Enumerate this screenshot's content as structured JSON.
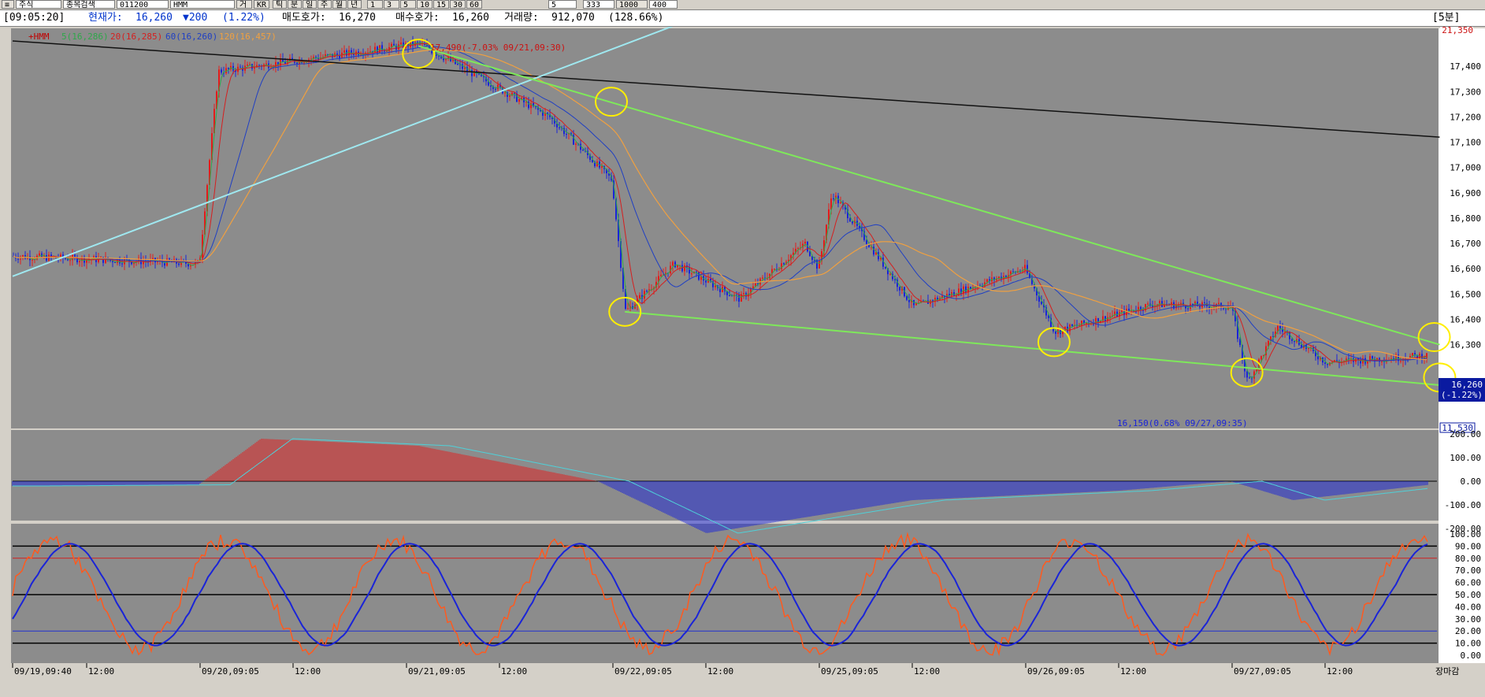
{
  "toolbar": {
    "market_select": "주식",
    "search_type": "종목검색",
    "code": "011200",
    "btn_prev": "거",
    "name": "HMM",
    "btn_kr": "KR",
    "period_tabs": [
      "틱",
      "분",
      "일",
      "주",
      "월",
      "년"
    ],
    "interval_tabs": [
      "1",
      "3",
      "5",
      "10",
      "15",
      "30",
      "60"
    ],
    "interval_value": "5",
    "count_value": "333",
    "count_total": "1000",
    "zoom_value": "400"
  },
  "infobar": {
    "time": "[09:05:20]",
    "price_label": "현재가:",
    "price": "16,260",
    "change": "▼200",
    "change_pct": "(1.22%)",
    "ask_label": "매도호가:",
    "ask": "16,270",
    "bid_label": "매수호가:",
    "bid": "16,260",
    "volume_label": "거래량:",
    "volume": "912,070",
    "volume_pct": "(128.66%)",
    "timeframe": "[5분]"
  },
  "legend": {
    "name": "HMM",
    "ma5": "5(16,286)",
    "ma20": "20(16,285)",
    "ma60": "60(16,260)",
    "ma120": "120(16,457)"
  },
  "annotations": {
    "high": "17,490(-7.03% 09/21,09:30)",
    "low": "16,150(0.68% 09/27,09:35)"
  },
  "price_axis": {
    "top_label": "21,350",
    "current_label": "16,260",
    "current_pct": "(-1.22%)",
    "bottom_label": "11,530"
  },
  "macd_axis": [
    "200.00",
    "100.00",
    "0.00",
    "-100.00",
    "-200.00"
  ],
  "stoch_axis": [
    "100.00",
    "90.00",
    "80.00",
    "70.00",
    "60.00",
    "50.00",
    "40.00",
    "30.00",
    "20.00",
    "10.00",
    "0.00"
  ],
  "time_axis": [
    "09/19,09:40",
    "12:00",
    "09/20,09:05",
    "12:00",
    "09/21,09:05",
    "12:00",
    "09/22,09:05",
    "12:00",
    "09/25,09:05",
    "12:00",
    "09/26,09:05",
    "12:00",
    "09/27,09:05",
    "12:00"
  ],
  "status": "장마감",
  "colors": {
    "bg": "#8c8c8c",
    "up": "#e31b1b",
    "down": "#1a24d8",
    "ma5": "#2ea84a",
    "ma20": "#d61f1f",
    "ma60": "#1f3fc4",
    "ma120": "#f0a040",
    "trend_green": "#7ee85a",
    "trend_cyan": "#9fe8f0",
    "trend_black": "#111111",
    "circle": "#ffee00"
  },
  "chart_data": {
    "type": "candlestick",
    "price_ylim": [
      16000,
      17500
    ],
    "price_ticks": [
      17400,
      17300,
      17200,
      17100,
      17000,
      16900,
      16800,
      16700,
      16600,
      16500,
      16400,
      16300
    ],
    "key_points": [
      {
        "time": "09/19,09:40",
        "price": 16650
      },
      {
        "time": "09/20,09:05",
        "price": 16620
      },
      {
        "time": "09/20,09:40",
        "price": 17380
      },
      {
        "time": "09/21,09:30",
        "price": 17490
      },
      {
        "time": "09/21,13:30",
        "price": 17200
      },
      {
        "time": "09/22,09:05",
        "price": 16950
      },
      {
        "time": "09/22,09:30",
        "price": 16430
      },
      {
        "time": "09/22,11:00",
        "price": 16620
      },
      {
        "time": "09/22,13:00",
        "price": 16480
      },
      {
        "time": "09/22,15:00",
        "price": 16700
      },
      {
        "time": "09/25,09:05",
        "price": 16600
      },
      {
        "time": "09/25,09:30",
        "price": 16900
      },
      {
        "time": "09/25,12:00",
        "price": 16450
      },
      {
        "time": "09/26,09:05",
        "price": 16600
      },
      {
        "time": "09/26,10:00",
        "price": 16350
      },
      {
        "time": "09/26,13:00",
        "price": 16460
      },
      {
        "time": "09/27,09:05",
        "price": 16450
      },
      {
        "time": "09/27,09:35",
        "price": 16150
      },
      {
        "time": "09/27,10:30",
        "price": 16370
      },
      {
        "time": "09/27,12:00",
        "price": 16230
      },
      {
        "time": "09/27,15:30",
        "price": 16260
      }
    ],
    "macd": {
      "ylim": [
        -200,
        200
      ],
      "key_points": [
        {
          "time": "09/19,09:40",
          "value": -20
        },
        {
          "time": "09/20,09:05",
          "value": -15
        },
        {
          "time": "09/20,11:00",
          "value": 180
        },
        {
          "time": "09/21,09:30",
          "value": 150
        },
        {
          "time": "09/21,15:00",
          "value": 0
        },
        {
          "time": "09/22,12:00",
          "value": -220
        },
        {
          "time": "09/25,12:00",
          "value": -80
        },
        {
          "time": "09/26,12:00",
          "value": -40
        },
        {
          "time": "09/27,09:05",
          "value": 0
        },
        {
          "time": "09/27,11:00",
          "value": -80
        },
        {
          "time": "09/27,15:30",
          "value": -10
        }
      ]
    },
    "stochastic": {
      "ylim": [
        0,
        100
      ],
      "levels": [
        80,
        50,
        20
      ]
    }
  }
}
